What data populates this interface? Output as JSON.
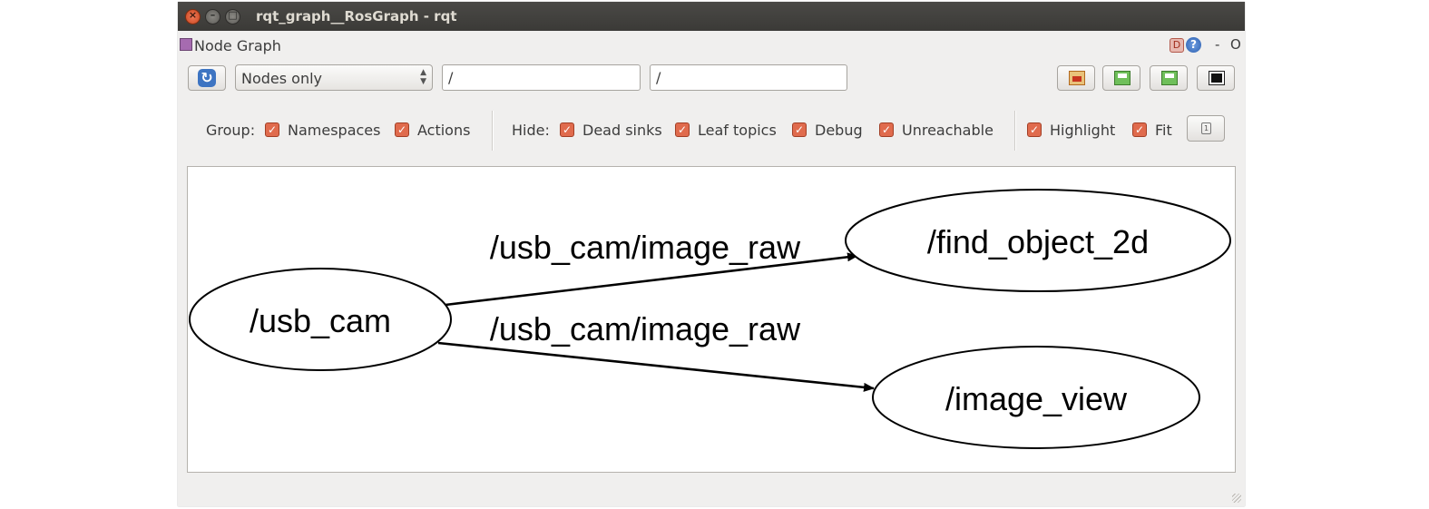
{
  "window": {
    "title": "rqt_graph__RosGraph - rqt"
  },
  "plugin": {
    "name": "Node Graph",
    "help_d": "D",
    "help_q": "?",
    "dash": "-",
    "o": "O"
  },
  "toolbar": {
    "refresh_glyph": "↻",
    "mode": "Nodes only",
    "filter1": "/",
    "filter2": "/"
  },
  "options": {
    "group_label": "Group:",
    "namespaces": "Namespaces",
    "actions": "Actions",
    "hide_label": "Hide:",
    "dead_sinks": "Dead sinks",
    "leaf_topics": "Leaf topics",
    "debug": "Debug",
    "unreachable": "Unreachable",
    "highlight": "Highlight",
    "fit": "Fit",
    "check": "✓",
    "small_btn_glyph": "1"
  },
  "graph": {
    "nodes": {
      "usb_cam": "/usb_cam",
      "find_object": "/find_object_2d",
      "image_view": "/image_view"
    },
    "edges": {
      "top": "/usb_cam/image_raw",
      "bottom": "/usb_cam/image_raw"
    }
  }
}
